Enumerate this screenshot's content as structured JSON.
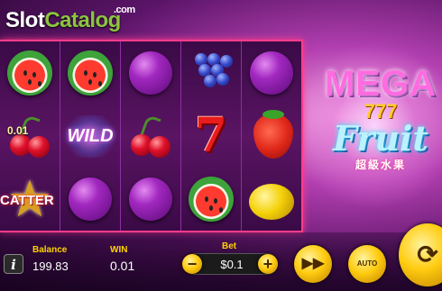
{
  "brand": {
    "part1": "Slot",
    "part2": "Catalog",
    "domain": ".com"
  },
  "game_logo": {
    "line1": "MEGA",
    "line2": "777",
    "line3": "Fruit",
    "line4": "超級水果"
  },
  "reels": [
    [
      "melon",
      "wild-cherry-win",
      "star-scatter"
    ],
    [
      "melon",
      "wild",
      "plum"
    ],
    [
      "plum",
      "cherry",
      "plum"
    ],
    [
      "grapes",
      "seven",
      "melon"
    ],
    [
      "plum",
      "strawberry",
      "lemon"
    ]
  ],
  "symbols": {
    "wild_label": "WILD",
    "scatter_label": "CATTER",
    "win_amount": "0.01"
  },
  "footer": {
    "balance_label": "Balance",
    "balance_value": "199.83",
    "win_label": "WIN",
    "win_value": "0.01",
    "bet_label": "Bet",
    "bet_value": "$0.1",
    "minus": "−",
    "plus": "+",
    "auto_label": "AUTO",
    "info_label": "i"
  },
  "colors": {
    "accent": "#ff3c8c",
    "gold": "#ffcc10",
    "label_yellow": "#ffd400"
  },
  "icons": {
    "info": "info-icon",
    "fast_forward": "fast-forward-icon",
    "spin": "spin-icon"
  }
}
